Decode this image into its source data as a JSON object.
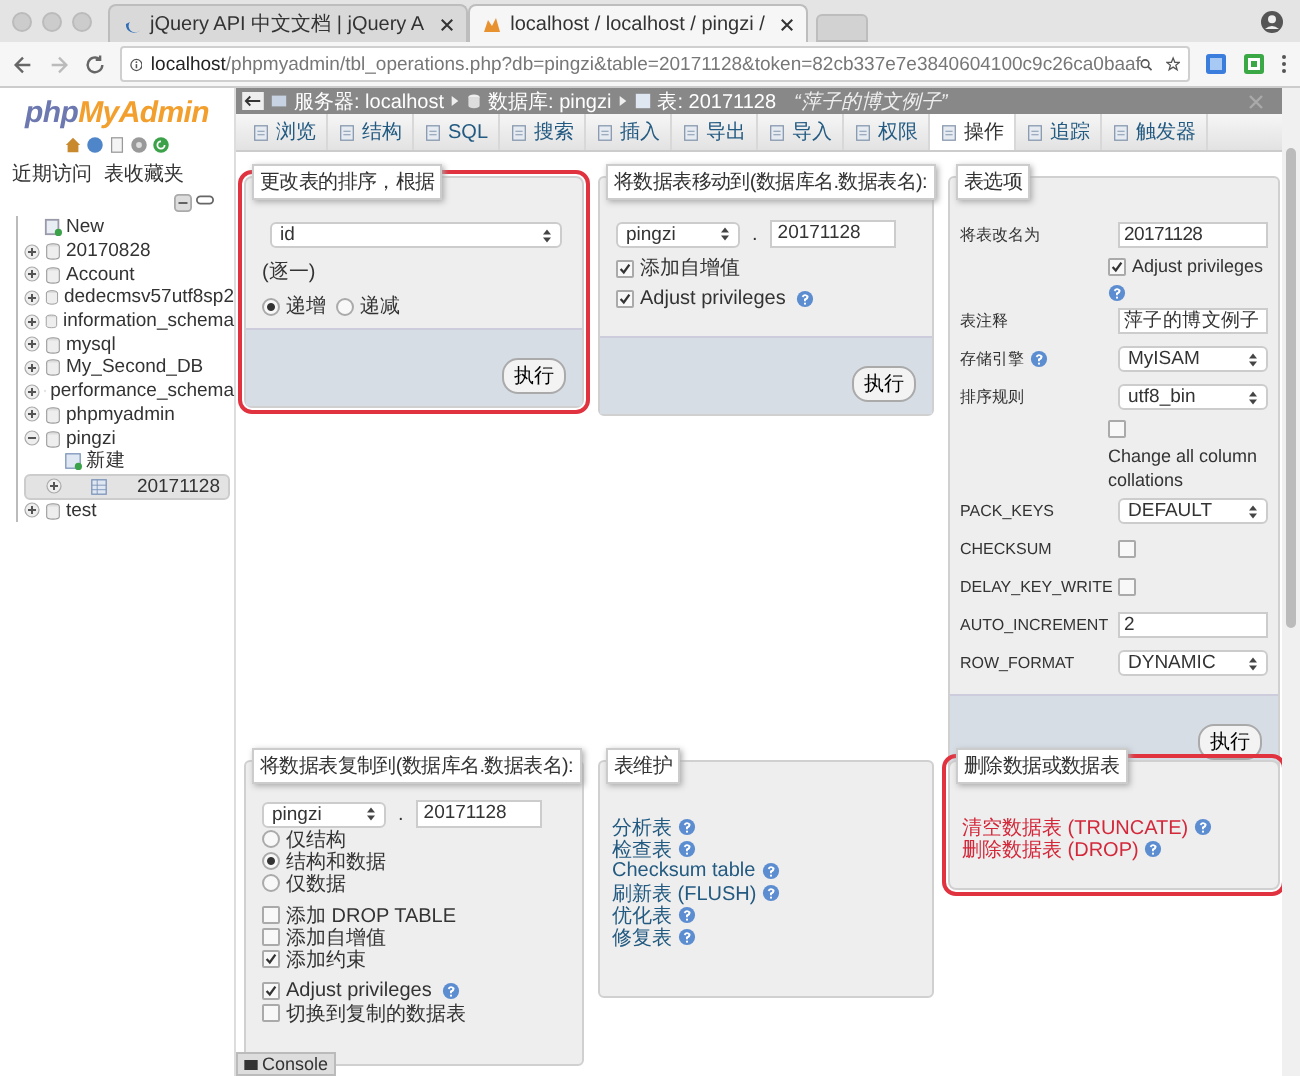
{
  "browser": {
    "tabs": [
      {
        "title": "jQuery API 中文文档 | jQuery A",
        "selected": false
      },
      {
        "title": "localhost / localhost / pingzi /",
        "selected": true
      }
    ],
    "url_host": "localhost",
    "url_path": "/phpmyadmin/tbl_operations.php?db=pingzi&table=20171128&token=82cb337e7e3840604100c9c26ca0baaf"
  },
  "sidebar": {
    "logo_php": "php",
    "logo_name": "MyAdmin",
    "links": [
      "近期访问",
      "表收藏夹"
    ],
    "tree": [
      {
        "label": "New",
        "kind": "new"
      },
      {
        "label": "20170828",
        "kind": "db",
        "expanded": false
      },
      {
        "label": "Account",
        "kind": "db",
        "expanded": false
      },
      {
        "label": "dedecmsv57utf8sp2",
        "kind": "db",
        "expanded": false
      },
      {
        "label": "information_schema",
        "kind": "db",
        "expanded": false
      },
      {
        "label": "mysql",
        "kind": "db",
        "expanded": false
      },
      {
        "label": "My_Second_DB",
        "kind": "db",
        "expanded": false
      },
      {
        "label": "performance_schema",
        "kind": "db",
        "expanded": false
      },
      {
        "label": "phpmyadmin",
        "kind": "db",
        "expanded": false
      },
      {
        "label": "pingzi",
        "kind": "db",
        "expanded": true,
        "children": [
          {
            "label": "新建",
            "kind": "new",
            "selected": false
          },
          {
            "label": "20171128",
            "kind": "table",
            "expanded": false,
            "selected": true
          }
        ]
      },
      {
        "label": "test",
        "kind": "db",
        "expanded": false
      }
    ]
  },
  "breadcrumb": {
    "server": "服务器: localhost",
    "database": "数据库: pingzi",
    "table": "表: 20171128",
    "comment": "“萍子的博文例子”"
  },
  "tabs": [
    {
      "label": "浏览",
      "selected": false
    },
    {
      "label": "结构",
      "selected": false
    },
    {
      "label": "SQL",
      "selected": false
    },
    {
      "label": "搜索",
      "selected": false
    },
    {
      "label": "插入",
      "selected": false
    },
    {
      "label": "导出",
      "selected": false
    },
    {
      "label": "导入",
      "selected": false
    },
    {
      "label": "权限",
      "selected": false
    },
    {
      "label": "操作",
      "selected": true
    },
    {
      "label": "追踪",
      "selected": false
    },
    {
      "label": "触发器",
      "selected": false
    }
  ],
  "order_panel": {
    "legend": "更改表的排序，根据",
    "highlighted": true,
    "column": "id",
    "note": "(逐一)",
    "directions": [
      {
        "label": "递增",
        "selected": true
      },
      {
        "label": "递减",
        "selected": false
      }
    ],
    "button": "执行"
  },
  "move_panel": {
    "legend": "将数据表移动到(数据库名.数据表名):",
    "highlighted": false,
    "database": "pingzi",
    "dot": ".",
    "table": "20171128",
    "options": [
      {
        "label": "添加自增值",
        "checked": true
      },
      {
        "label": "Adjust privileges",
        "checked": true,
        "help": true
      }
    ],
    "button": "执行"
  },
  "options_panel": {
    "legend": "表选项",
    "highlighted": false,
    "rows": [
      {
        "kind": "input",
        "label": "将表改名为",
        "value": "20171128"
      },
      {
        "kind": "checkbox",
        "text": "Adjust privileges",
        "checked": true,
        "help": true
      },
      {
        "kind": "input",
        "label": "表注释",
        "value": "萍子的博文例子"
      },
      {
        "kind": "select",
        "label": "存储引擎",
        "help": true,
        "value": "MyISAM"
      },
      {
        "kind": "select",
        "label": "排序规则",
        "value": "utf8_bin"
      },
      {
        "kind": "checkbox",
        "text": "Change all column collations",
        "checked": false
      },
      {
        "kind": "select",
        "label": "PACK_KEYS",
        "value": "DEFAULT"
      },
      {
        "kind": "flag",
        "label": "CHECKSUM",
        "checked": false
      },
      {
        "kind": "flag",
        "label": "DELAY_KEY_WRITE",
        "checked": false
      },
      {
        "kind": "input",
        "label": "AUTO_INCREMENT",
        "value": "2"
      },
      {
        "kind": "select",
        "label": "ROW_FORMAT",
        "value": "DYNAMIC"
      }
    ],
    "button": "执行"
  },
  "copy_panel": {
    "legend": "将数据表复制到(数据库名.数据表名):",
    "highlighted": false,
    "database": "pingzi",
    "dot": ".",
    "table": "20171128",
    "modes": [
      {
        "label": "仅结构",
        "selected": false
      },
      {
        "label": "结构和数据",
        "selected": true
      },
      {
        "label": "仅数据",
        "selected": false
      }
    ],
    "options": [
      {
        "label": "添加 DROP TABLE",
        "checked": false
      },
      {
        "label": "添加自增值",
        "checked": false
      },
      {
        "label": "添加约束",
        "checked": true
      }
    ],
    "options2": [
      {
        "label": "Adjust privileges",
        "checked": true,
        "help": true
      },
      {
        "label": "切换到复制的数据表",
        "checked": false
      }
    ]
  },
  "maintenance_panel": {
    "legend": "表维护",
    "highlighted": false,
    "links": [
      "分析表",
      "检查表",
      "Checksum table",
      "刷新表 (FLUSH)",
      "优化表",
      "修复表"
    ]
  },
  "delete_panel": {
    "legend": "删除数据或数据表",
    "highlighted": true,
    "links": [
      "清空数据表 (TRUNCATE)",
      "删除数据表 (DROP)"
    ]
  },
  "console": "Console"
}
